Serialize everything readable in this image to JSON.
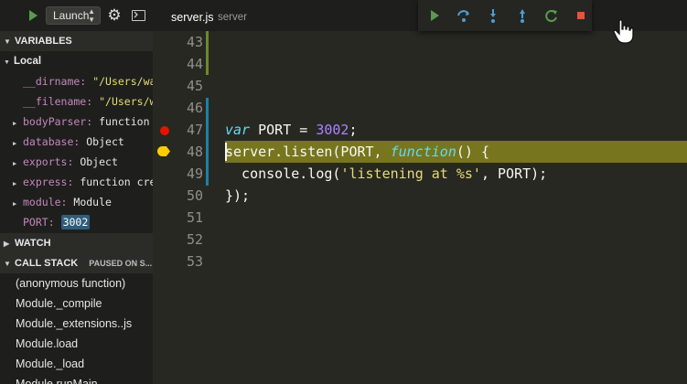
{
  "toolbar": {
    "launch_label": "Launch",
    "icons": {
      "play": "play-icon",
      "gear": "gear-icon",
      "console": "console-icon"
    }
  },
  "sections": {
    "variables": "VARIABLES",
    "local": "Local",
    "watch": "WATCH",
    "call_stack": "CALL STACK",
    "call_stack_status": "PAUSED ON S..."
  },
  "variables": [
    {
      "name": "__dirname:",
      "value": "\"/Users/wa...",
      "expandable": false,
      "kind": "string"
    },
    {
      "name": "__filename:",
      "value": "\"/Users/w...",
      "expandable": false,
      "kind": "string"
    },
    {
      "name": "bodyParser:",
      "value": "function ...",
      "expandable": true,
      "kind": "object"
    },
    {
      "name": "database:",
      "value": "Object",
      "expandable": true,
      "kind": "object"
    },
    {
      "name": "exports:",
      "value": "Object",
      "expandable": true,
      "kind": "object"
    },
    {
      "name": "express:",
      "value": "function cre...",
      "expandable": true,
      "kind": "object"
    },
    {
      "name": "module:",
      "value": "Module",
      "expandable": true,
      "kind": "object"
    },
    {
      "name": "PORT:",
      "value": "3002",
      "expandable": false,
      "kind": "number"
    }
  ],
  "call_stack": [
    "(anonymous function)",
    "Module._compile",
    "Module._extensions..js",
    "Module.load",
    "Module._load",
    "Module.runMain"
  ],
  "editor": {
    "tab_file": "server.js",
    "tab_folder": "server",
    "lines": [
      {
        "n": "43",
        "code": ""
      },
      {
        "n": "44",
        "code": ""
      },
      {
        "n": "45",
        "code": ""
      },
      {
        "n": "46",
        "code": ""
      },
      {
        "n": "47",
        "code": "var PORT = 3002;"
      },
      {
        "n": "48",
        "code": "server.listen(PORT, function() {"
      },
      {
        "n": "49",
        "code": "  console.log('listening at %s', PORT);"
      },
      {
        "n": "50",
        "code": "});"
      },
      {
        "n": "51",
        "code": ""
      },
      {
        "n": "52",
        "code": ""
      },
      {
        "n": "53",
        "code": ""
      }
    ],
    "current_line": "48",
    "breakpoint_line": "47"
  },
  "debug_toolbar": {
    "buttons": [
      {
        "name": "continue-icon",
        "color": "#5b9b4f"
      },
      {
        "name": "step-over-icon",
        "color": "#4a9fd8"
      },
      {
        "name": "step-into-icon",
        "color": "#4a9fd8"
      },
      {
        "name": "step-out-icon",
        "color": "#4a9fd8"
      },
      {
        "name": "restart-icon",
        "color": "#5b9b4f"
      },
      {
        "name": "stop-icon",
        "color": "#e5533d"
      }
    ]
  },
  "colors": {
    "breakpoint": "#e51400",
    "current_line_arrow": "#ffcc00",
    "current_line_highlight": "#77761f",
    "accent_blue": "#4a9fd8"
  }
}
